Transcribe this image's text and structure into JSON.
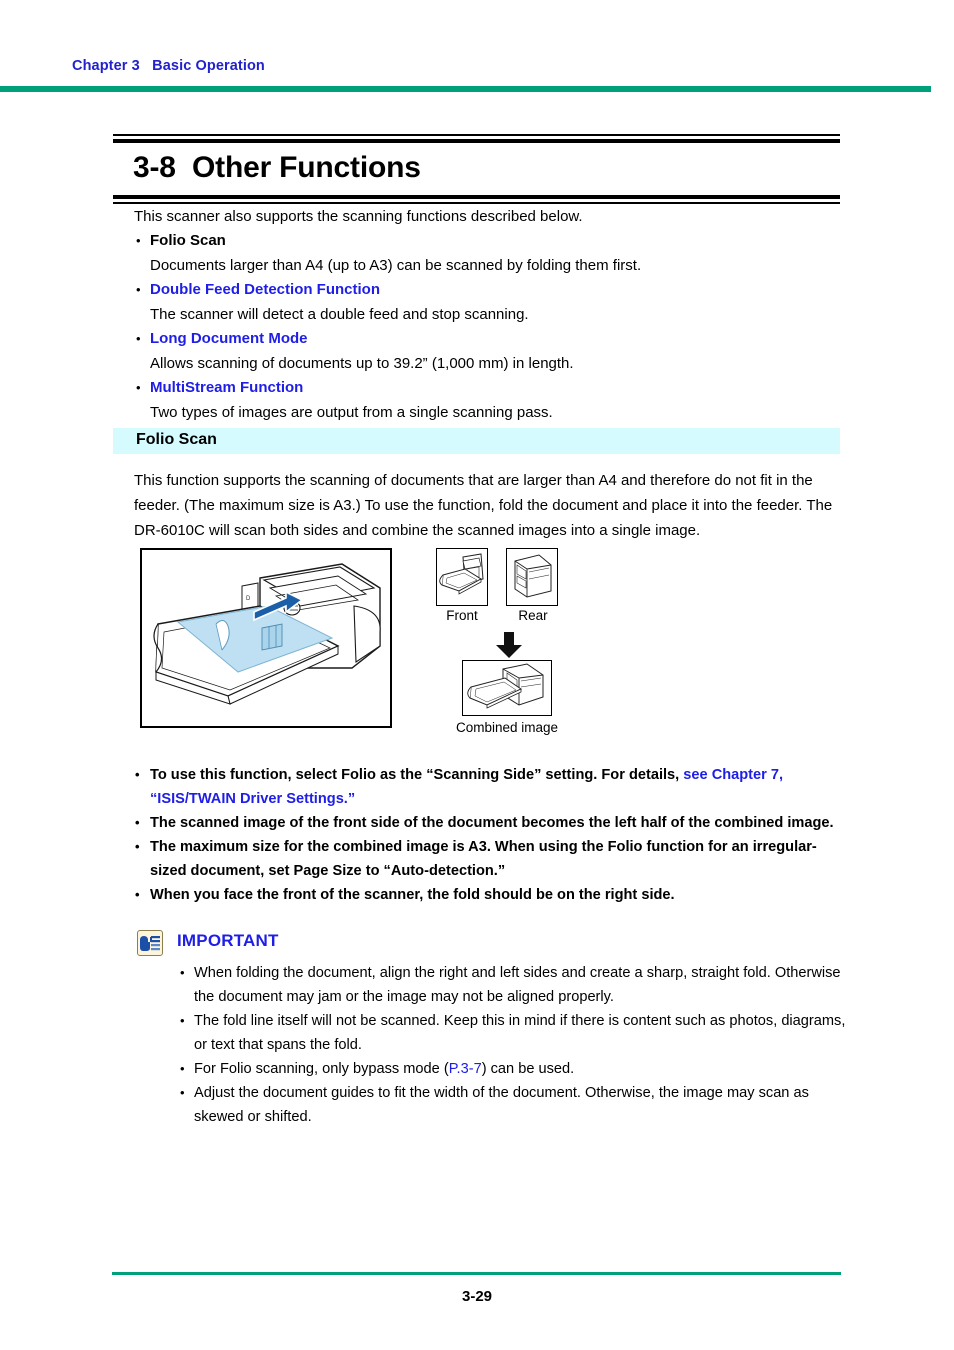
{
  "header": {
    "chapter_label": "Chapter 3   Basic Operation",
    "rule_color": "#00a07a",
    "link_color": "#2222cc"
  },
  "title": {
    "text": "3-8  Other Functions"
  },
  "intro": {
    "paragraph": "This scanner also supports the scanning functions described below.",
    "bullet_char": "•",
    "items": [
      {
        "title": "Folio Scan",
        "is_link": false,
        "desc": "Documents larger than A4 (up to A3) can be scanned by folding them first."
      },
      {
        "title": "Double Feed Detection Function",
        "is_link": true,
        "desc": "The scanner will detect a double feed and stop scanning."
      },
      {
        "title": "Long Document Mode",
        "is_link": true,
        "desc": "Allows scanning of documents up to 39.2” (1,000 mm) in length."
      },
      {
        "title": "MultiStream Function",
        "is_link": true,
        "desc": "Two types of images are output from a single scanning pass."
      }
    ]
  },
  "subsection": {
    "heading": "Folio Scan",
    "band_color": "#d6fbff",
    "paragraph": "This function supports the scanning of documents that are larger than A4 and therefore do not fit in the feeder. (The maximum size is A3.) To use the function, fold the document and place it into the feeder. The DR-6010C will scan both sides and combine the scanned images into a single image."
  },
  "figure": {
    "main_illustration_name": "scanner-feeding-folded-document-illustration",
    "document_color": "#bfe0f2",
    "arrow_color": "#1b5fa8",
    "thumbnails": [
      {
        "caption": "Front",
        "icon": "scanner-front-view-thumbnail"
      },
      {
        "caption": "Rear",
        "icon": "scanner-rear-view-thumbnail"
      }
    ],
    "flow_arrow": "down-arrow-icon",
    "result": {
      "caption": "Combined image",
      "icon": "scanner-combined-image-thumbnail"
    }
  },
  "notes": {
    "bullet_char": "•",
    "items": [
      {
        "segments": [
          {
            "text": "To use this function, select Folio as the “Scanning Side” setting. For details, ",
            "link": false
          },
          {
            "text": "see Chapter 7, “ISIS/TWAIN Driver Settings.”",
            "link": true
          }
        ]
      },
      {
        "segments": [
          {
            "text": "The scanned image of the front side of the document becomes the left half of the combined image.",
            "link": false
          }
        ]
      },
      {
        "segments": [
          {
            "text": "The maximum size for the combined image is A3. When using the Folio function for an irregular-sized document, set Page Size to “Auto-detection.”",
            "link": false
          }
        ]
      },
      {
        "segments": [
          {
            "text": "When you face the front of the scanner, the fold should be on the right side.",
            "link": false
          }
        ]
      }
    ]
  },
  "important": {
    "icon": "important-pointing-hand-icon",
    "icon_bg": "#fdf4dc",
    "title": "IMPORTANT",
    "title_color": "#1e1ee6",
    "bullet_char": "•",
    "items": [
      {
        "segments": [
          {
            "text": "When folding the document, align the right and left sides and create a sharp, straight fold. Otherwise the document may jam or the image may not be aligned properly.",
            "link": false
          }
        ]
      },
      {
        "segments": [
          {
            "text": "The fold line itself will not be scanned. Keep this in mind if there is content such as photos, diagrams, or text that spans the fold.",
            "link": false
          }
        ]
      },
      {
        "segments": [
          {
            "text": "For Folio scanning, only bypass mode (",
            "link": false
          },
          {
            "text": "P.3-7",
            "link": true
          },
          {
            "text": ") can be used.",
            "link": false
          }
        ]
      },
      {
        "segments": [
          {
            "text": "Adjust the document guides to fit the width of the document. Otherwise, the image may scan as skewed or shifted.",
            "link": false
          }
        ]
      }
    ]
  },
  "footer": {
    "page_number": "3-29",
    "rule_color": "#00a07a"
  }
}
